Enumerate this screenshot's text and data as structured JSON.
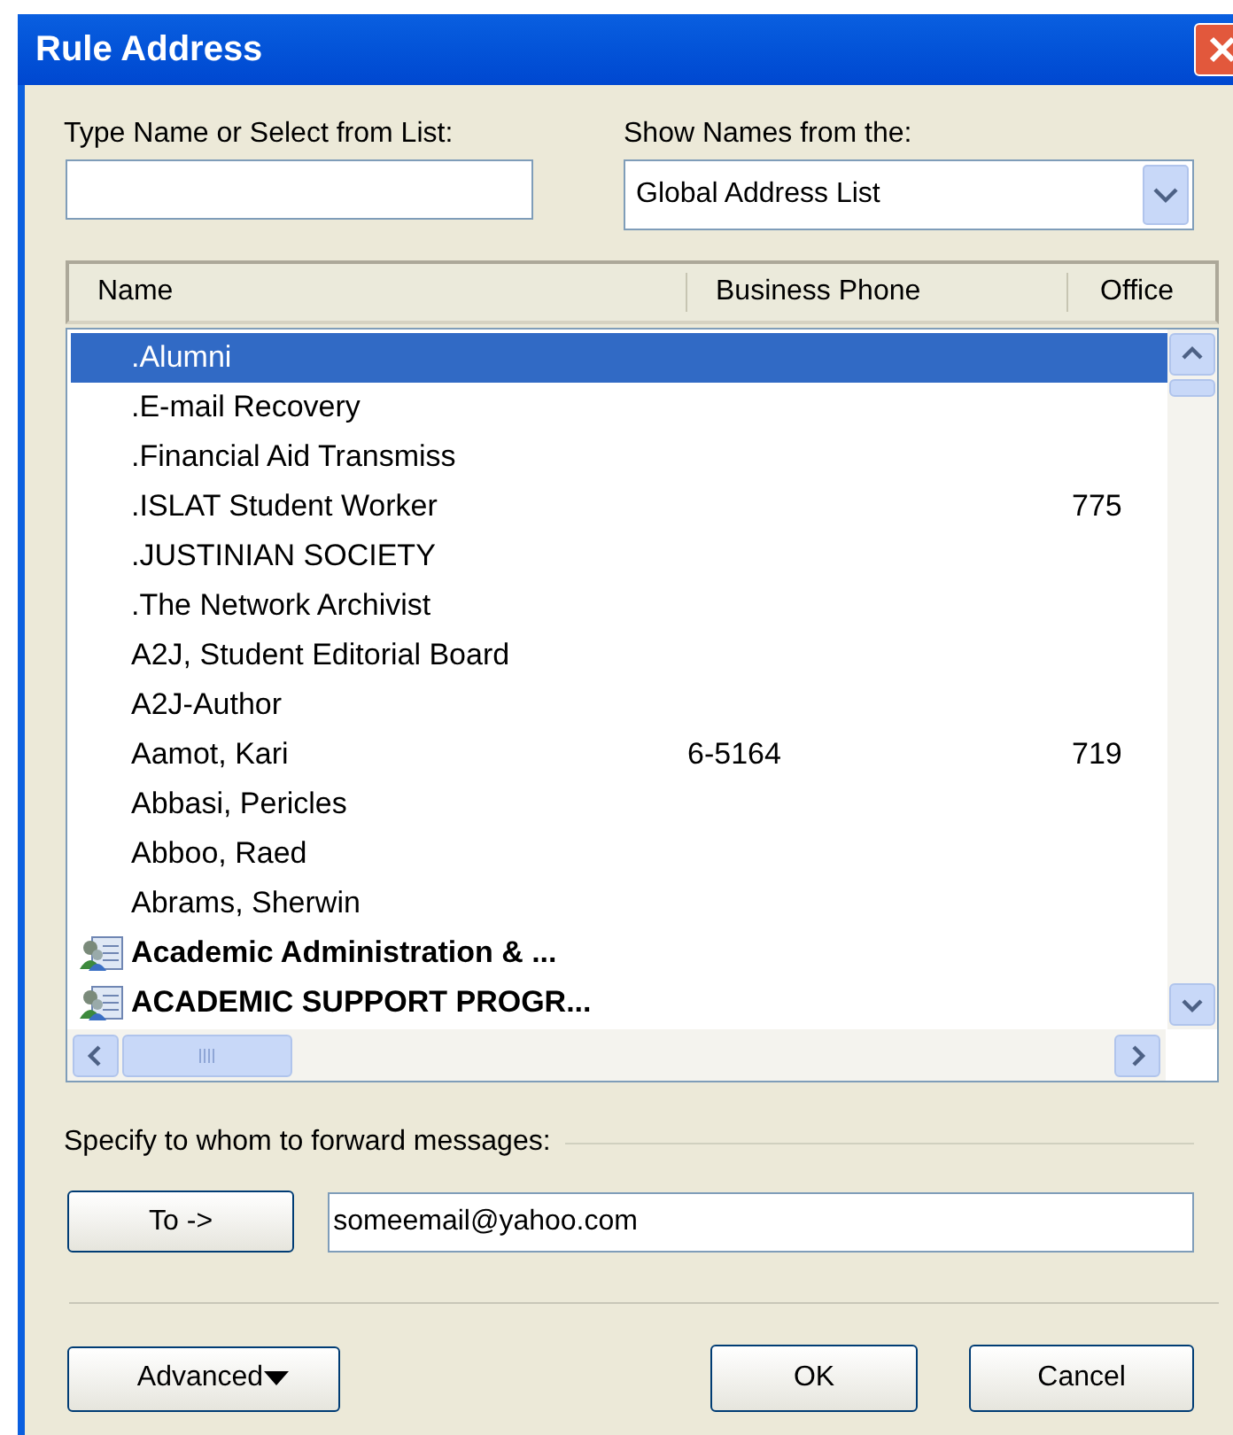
{
  "window": {
    "title": "Rule Address"
  },
  "name_field": {
    "label": "Type Name or Select from List:"
  },
  "address_book": {
    "label": "Show Names from the:",
    "value": "Global Address List"
  },
  "table": {
    "columns": [
      "Name",
      "Business Phone",
      "Office"
    ],
    "rows": [
      {
        "kind": "person",
        "name": ".Alumni",
        "selected": true
      },
      {
        "kind": "person",
        "name": ".E-mail Recovery",
        "selected": false
      },
      {
        "kind": "person",
        "name": ".Financial Aid Transmiss",
        "selected": false
      },
      {
        "kind": "person",
        "name": ".ISLAT Student Worker",
        "office": "775",
        "selected": false
      },
      {
        "kind": "person",
        "name": ".JUSTINIAN SOCIETY",
        "selected": false
      },
      {
        "kind": "person",
        "name": ".The Network Archivist",
        "selected": false
      },
      {
        "kind": "person",
        "name": "A2J, Student Editorial Board",
        "selected": false
      },
      {
        "kind": "person",
        "name": "A2J-Author",
        "selected": false
      },
      {
        "kind": "person",
        "name": "Aamot, Kari",
        "phone": "6-5164",
        "office": "719",
        "selected": false
      },
      {
        "kind": "person",
        "name": "Abbasi, Pericles",
        "selected": false
      },
      {
        "kind": "person",
        "name": "Abboo, Raed",
        "selected": false
      },
      {
        "kind": "person",
        "name": "Abrams, Sherwin",
        "selected": false
      },
      {
        "kind": "group",
        "name": "Academic Administration & ...",
        "selected": false
      },
      {
        "kind": "group",
        "name": "ACADEMIC SUPPORT PROGR...",
        "selected": false
      }
    ]
  },
  "forward": {
    "label": "Specify to whom to forward messages:",
    "to_button": "To ->",
    "value": "someemail@yahoo.com"
  },
  "buttons": {
    "advanced": "Advanced",
    "ok": "OK",
    "cancel": "Cancel"
  }
}
